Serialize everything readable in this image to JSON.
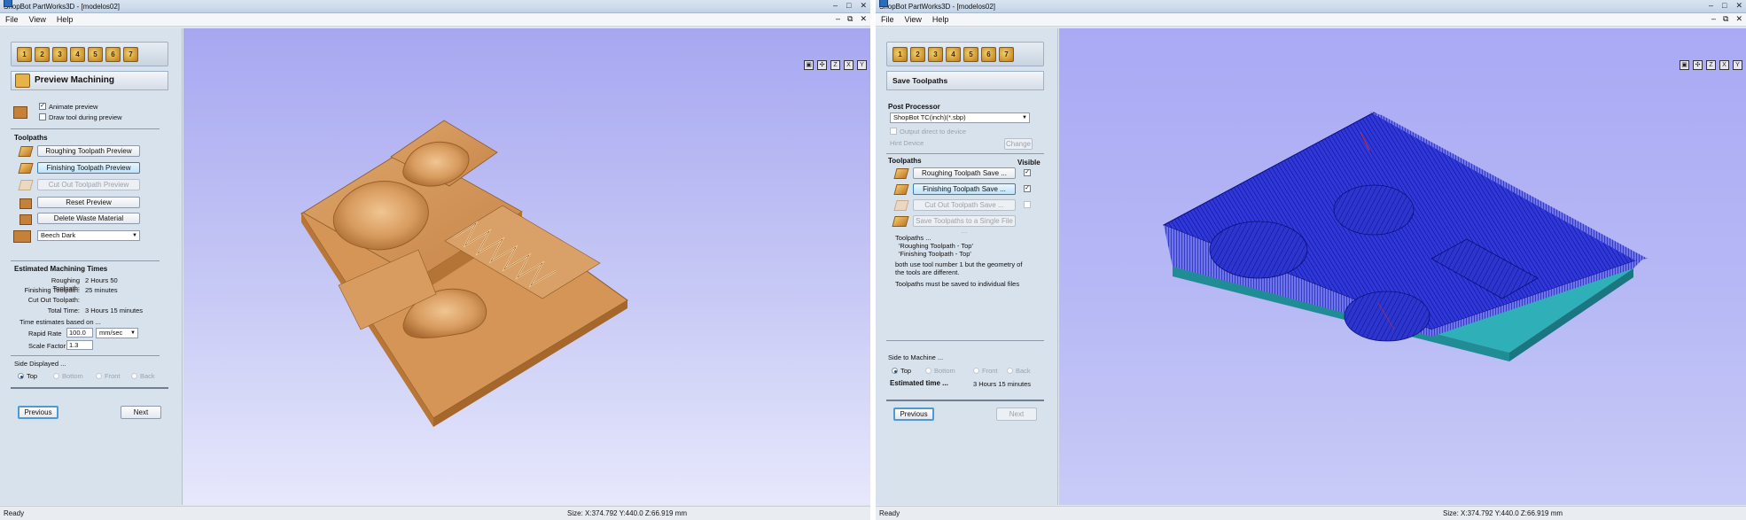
{
  "left": {
    "title": "ShopBot PartWorks3D - [modelos02]",
    "menu": [
      "File",
      "View",
      "Help"
    ],
    "icon_bar": [
      "1",
      "2",
      "3",
      "4",
      "5",
      "6",
      "7"
    ],
    "header": "Preview Machining",
    "animate_preview": "Animate preview",
    "draw_tool": "Draw tool during preview",
    "toolpaths_label": "Toolpaths",
    "buttons": {
      "roughing": "Roughing Toolpath Preview",
      "finishing": "Finishing Toolpath Preview",
      "cutout": "Cut Out Toolpath Preview",
      "reset": "Reset Preview",
      "delete_waste": "Delete Waste Material"
    },
    "material": "Beech Dark",
    "est_title": "Estimated Machining Times",
    "times": [
      {
        "label": "Roughing Toolpath:",
        "value": "2 Hours 50"
      },
      {
        "label": "Finishing Toolpath:",
        "value": "25 minutes"
      },
      {
        "label": "Cut Out Toolpath:",
        "value": ""
      },
      {
        "label": "Total Time:",
        "value": "3 Hours 15 minutes"
      }
    ],
    "based_on": "Time estimates based on ...",
    "rapid_label": "Rapid Rate",
    "rapid_value": "100.0",
    "rapid_unit": "mm/sec",
    "scale_label": "Scale Factor",
    "scale_value": "1.3",
    "side_label": "Side Displayed ...",
    "sides": [
      "Top",
      "Bottom",
      "Front",
      "Back"
    ],
    "previous": "Previous",
    "next": "Next",
    "status": "Ready",
    "size": "Size: X:374.792 Y:440.0 Z:66.919 mm"
  },
  "right": {
    "title": "ShopBot PartWorks3D - [modelos02]",
    "menu": [
      "File",
      "View",
      "Help"
    ],
    "icon_bar": [
      "1",
      "2",
      "3",
      "4",
      "5",
      "6",
      "7"
    ],
    "header": "Save Toolpaths",
    "post_label": "Post Processor",
    "post_value": "ShopBot TC(inch)(*.sbp)",
    "output_direct": "Output direct to device",
    "hint_label": "Hint Device",
    "change": "Change",
    "toolpaths_label": "Toolpaths",
    "visible_label": "Visible",
    "buttons": {
      "roughing": "Roughing Toolpath Save ...",
      "finishing": "Finishing Toolpath Save ...",
      "cutout": "Cut Out Toolpath Save ...",
      "single": "Save Toolpaths to a Single File ..."
    },
    "info": [
      "Toolpaths ...",
      "'Roughing Toolpath - Top'",
      "'Finishing Toolpath - Top'",
      "both use  tool number  1 but the geometry of",
      "the tools are different.",
      "Toolpaths must be saved to individual files"
    ],
    "side_label": "Side to Machine ...",
    "sides": [
      "Top",
      "Bottom",
      "Front",
      "Back"
    ],
    "est_label": "Estimated time ...",
    "est_value": "3 Hours 15 minutes",
    "previous": "Previous",
    "next": "Next",
    "status": "Ready",
    "size": "Size: X:374.792 Y:440.0 Z:66.919 mm"
  },
  "view_buttons": [
    "▣",
    "✣",
    "Z",
    "X",
    "Y"
  ]
}
